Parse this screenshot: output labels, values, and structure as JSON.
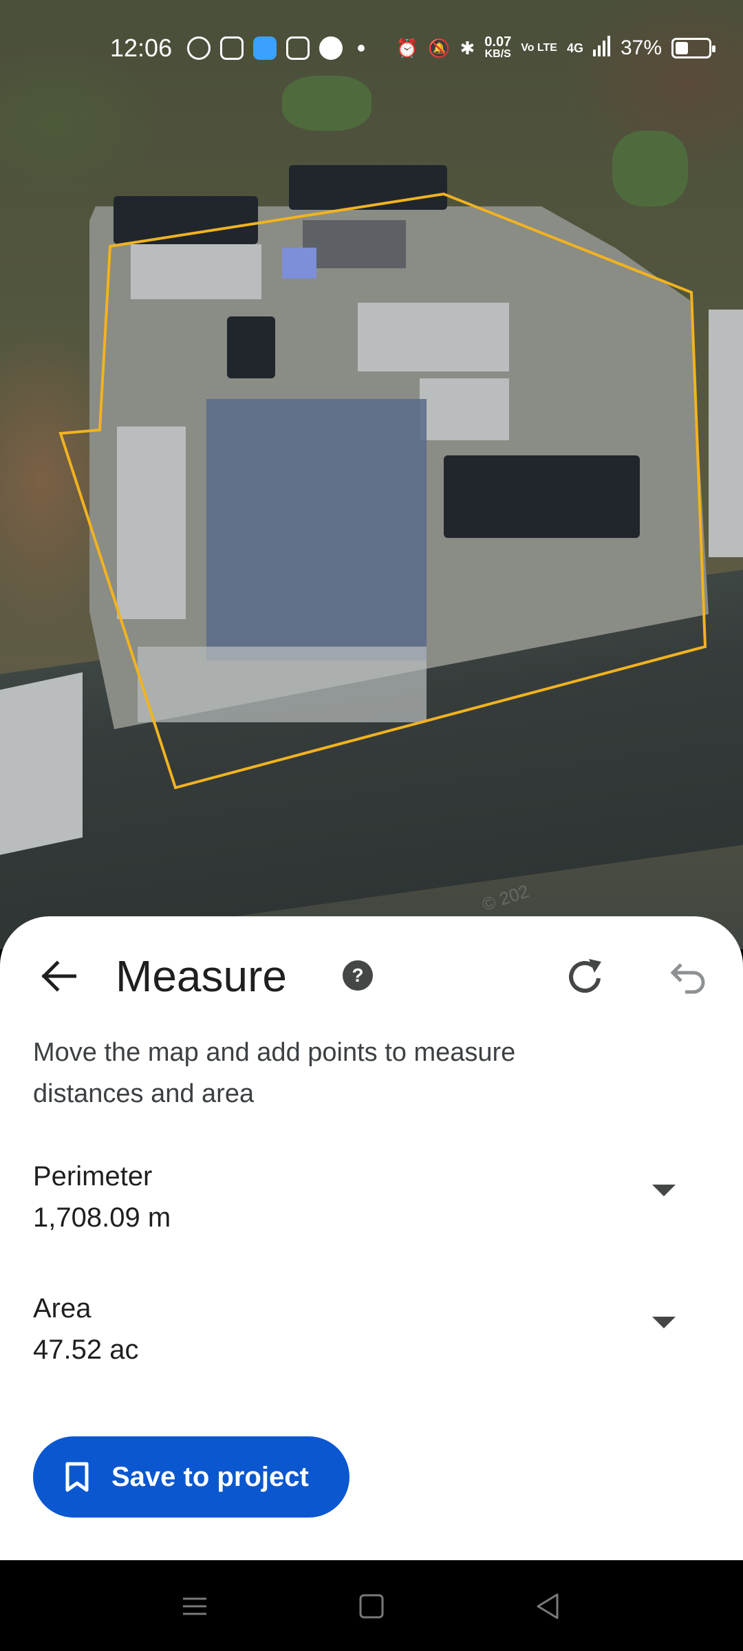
{
  "status_bar": {
    "time": "12:06",
    "net_speed": "0.07",
    "net_speed_unit": "KB/S",
    "volte": "Vo LTE",
    "network": "4G",
    "battery": "37%",
    "icons": [
      "whatsapp-icon",
      "instagram-icon",
      "app-icon",
      "calculator-icon",
      "phone-icon",
      "dot-icon",
      "alarm-icon",
      "mute-icon",
      "bluetooth-icon",
      "signal-icon",
      "battery-icon"
    ]
  },
  "map": {
    "outline_color": "#f2b31f",
    "watermark": "© 202"
  },
  "measure_panel": {
    "title": "Measure",
    "hint": "Move the map and add points to measure distances and area",
    "back_icon": "arrow-left-icon",
    "help_icon": "help-icon",
    "redo_icon": "redo-icon",
    "undo_icon": "undo-icon",
    "perimeter": {
      "label": "Perimeter",
      "value": "1,708.09 m"
    },
    "area": {
      "label": "Area",
      "value": "47.52 ac"
    },
    "save_button": {
      "label": "Save to project",
      "icon": "bookmark-icon",
      "color": "#0b57d0"
    }
  },
  "nav_bar": {
    "items": [
      "menu-icon",
      "home-icon",
      "back-icon"
    ]
  }
}
